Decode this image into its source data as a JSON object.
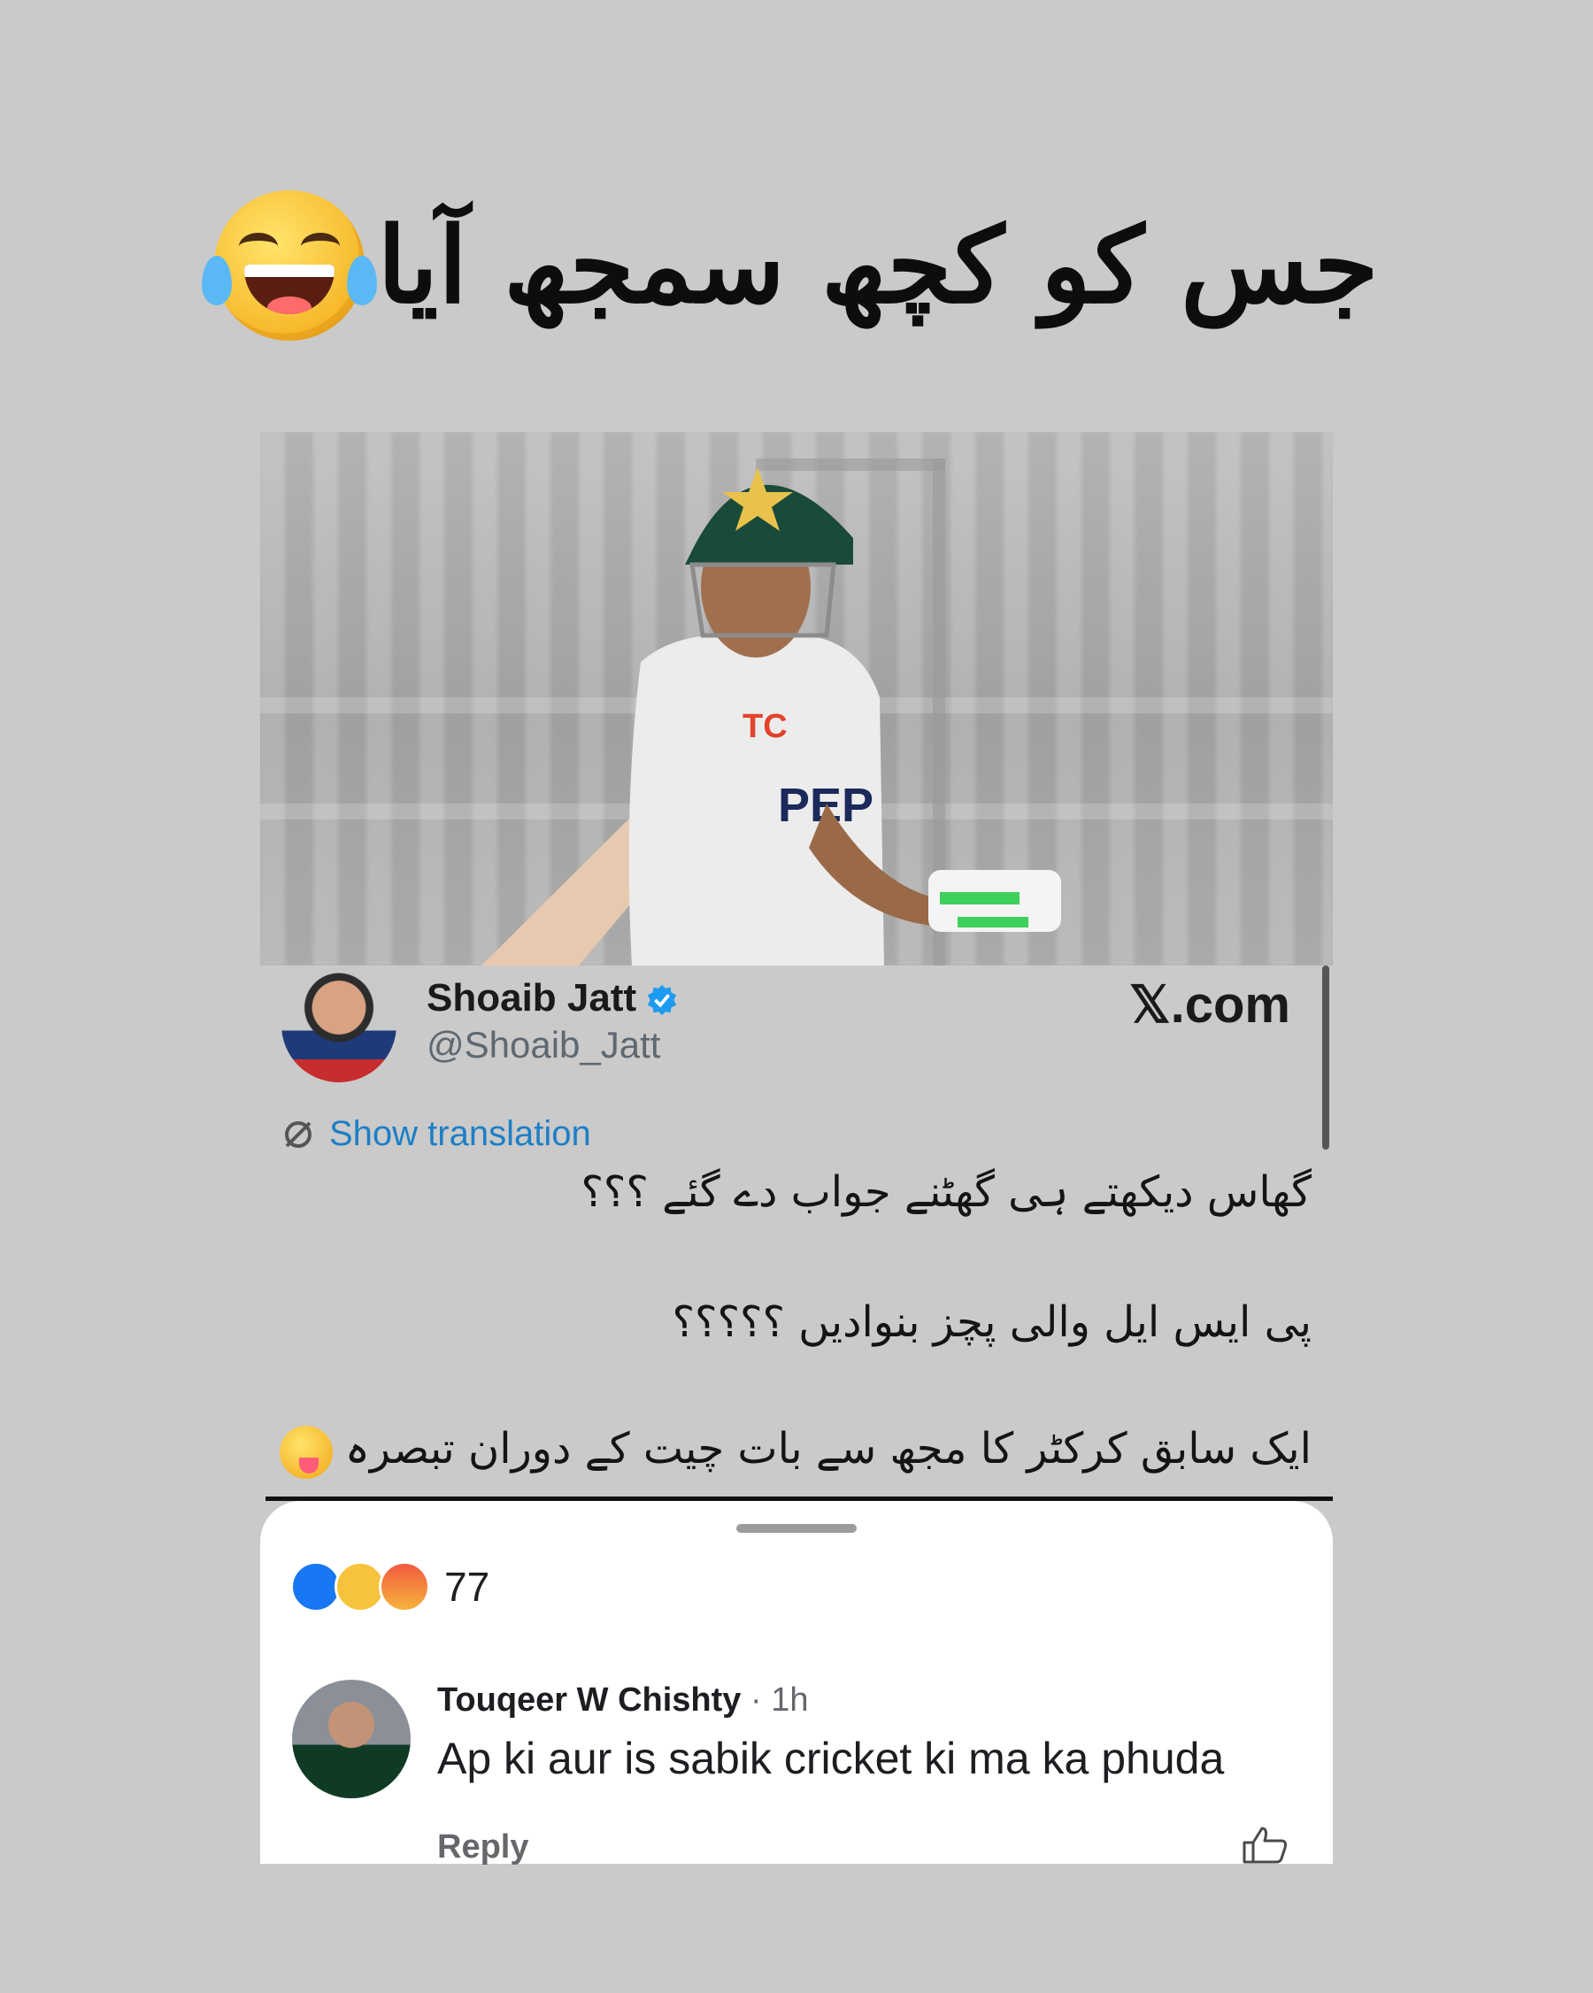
{
  "headline": {
    "text": "جس کو کچھ سمجھ آیا",
    "emoji": "laughing-tears-emoji"
  },
  "tweet": {
    "author_name": "Shoaib Jatt",
    "author_handle": "@Shoaib_Jatt",
    "source": "𝕏.com",
    "translate_label": "Show translation",
    "lines": [
      "گھاس دیکھتے ہی گھٹنے جواب دے گئے ؟؟؟",
      "پی ایس ایل والی پچز بنوادیں ؟؟؟؟؟",
      "ایک سابق کرکٹر کا مجھ سے بات چیت کے دوران تبصرہ"
    ],
    "colors": {
      "link": "#1d7fc6",
      "verified": "#1d9bf0"
    }
  },
  "reactions": {
    "count": "77",
    "types": [
      "like",
      "haha",
      "angry"
    ]
  },
  "comment": {
    "author": "Touqeer W Chishty",
    "time": "· 1h",
    "text": "Ap ki aur is sabik cricket ki ma ka phuda",
    "reply_label": "Reply"
  }
}
